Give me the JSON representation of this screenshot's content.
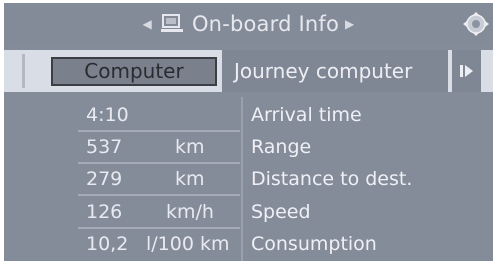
{
  "header": {
    "title": "On-board Info"
  },
  "tabs": {
    "computer": "Computer",
    "journey": "Journey computer"
  },
  "rows": [
    {
      "value": "4:10",
      "unit": "",
      "label": "Arrival time"
    },
    {
      "value": "537",
      "unit": "km",
      "label": "Range"
    },
    {
      "value": "279",
      "unit": "km",
      "label": "Distance to dest."
    },
    {
      "value": "126",
      "unit": "km/h",
      "label": "Speed"
    },
    {
      "value": "10,2",
      "unit": "l/100 km",
      "label": "Consumption"
    }
  ],
  "icons": {
    "prev": "chevron-left-icon",
    "next": "chevron-right-icon",
    "monitor": "monitor-icon",
    "controller": "controller-knob-icon",
    "tab_next": "play-right-icon"
  },
  "colors": {
    "background": "#848c9a",
    "tab_active": "#d9dde5",
    "text": "#e8eaf0"
  }
}
